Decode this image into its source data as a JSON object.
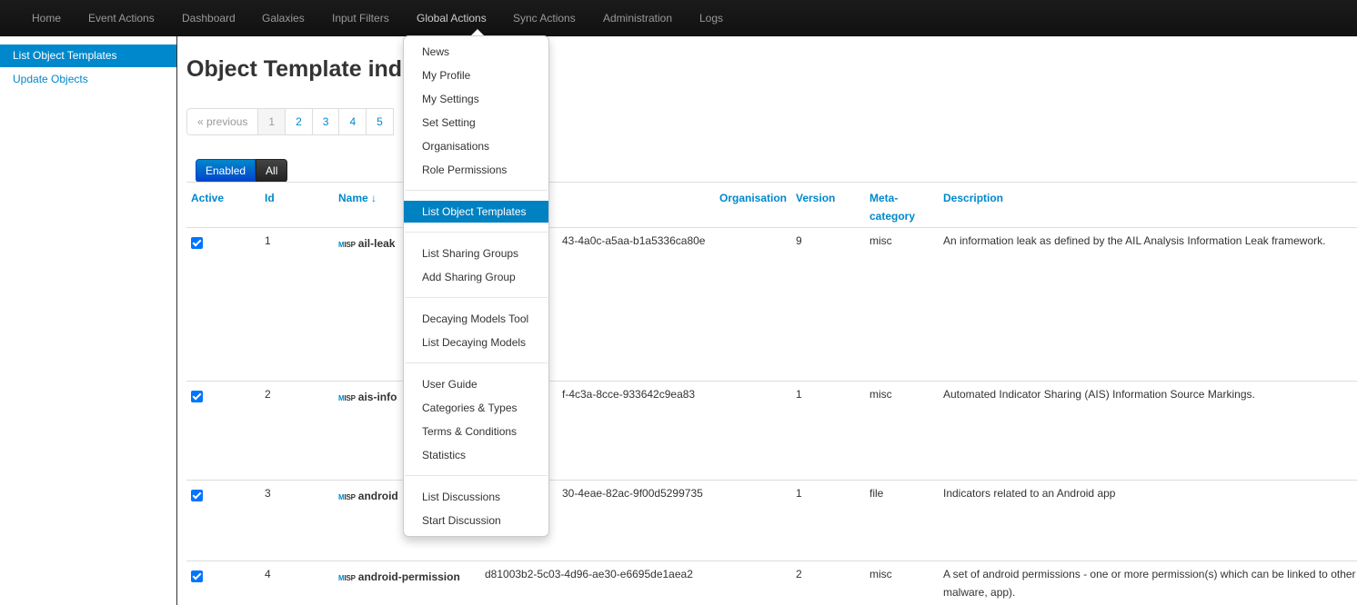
{
  "navbar": {
    "items": [
      "Home",
      "Event Actions",
      "Dashboard",
      "Galaxies",
      "Input Filters",
      "Global Actions",
      "Sync Actions",
      "Administration",
      "Logs"
    ]
  },
  "sidebar": {
    "items": [
      "List Object Templates",
      "Update Objects"
    ]
  },
  "page": {
    "title": "Object Template index"
  },
  "pagination": {
    "previous": "« previous",
    "pages": [
      "1",
      "2",
      "3",
      "4",
      "5"
    ]
  },
  "filters": {
    "enabled": "Enabled",
    "all": "All"
  },
  "table": {
    "headers": {
      "active": "Active",
      "id": "Id",
      "name": "Name ↓",
      "organisation": "Organisation",
      "version": "Version",
      "meta_category_1": "Meta-",
      "meta_category_2": "category",
      "description": "Description"
    },
    "logo_text": {
      "m": "M",
      "rest": "ISP"
    },
    "rows": [
      {
        "id": "1",
        "name": "ail-leak",
        "uuid": "43-4a0c-a5aa-b1a5336ca80e",
        "version": "9",
        "meta": "misc",
        "description": "An information leak as defined by the AIL Analysis Information Leak framework.",
        "description2": ""
      },
      {
        "id": "2",
        "name": "ais-info",
        "uuid": "f-4c3a-8cce-933642c9ea83",
        "version": "1",
        "meta": "misc",
        "description": "Automated Indicator Sharing (AIS) Information Source Markings.",
        "description2": ""
      },
      {
        "id": "3",
        "name": "android",
        "uuid": "30-4eae-82ac-9f00d5299735",
        "version": "1",
        "meta": "file",
        "description": "Indicators related to an Android app",
        "description2": ""
      },
      {
        "id": "4",
        "name": "android-permission",
        "uuid": "d81003b2-5c03-4d96-ae30-e6695de1aea2",
        "version": "2",
        "meta": "misc",
        "description": "A set of android permissions - one or more permission(s) which can be linked to other",
        "description2": "malware, app)."
      }
    ]
  },
  "dropdown": {
    "groups": [
      [
        "News",
        "My Profile",
        "My Settings",
        "Set Setting",
        "Organisations",
        "Role Permissions"
      ],
      [
        "List Object Templates"
      ],
      [
        "List Sharing Groups",
        "Add Sharing Group"
      ],
      [
        "Decaying Models Tool",
        "List Decaying Models"
      ],
      [
        "User Guide",
        "Categories & Types",
        "Terms & Conditions",
        "Statistics"
      ],
      [
        "List Discussions",
        "Start Discussion"
      ]
    ]
  }
}
